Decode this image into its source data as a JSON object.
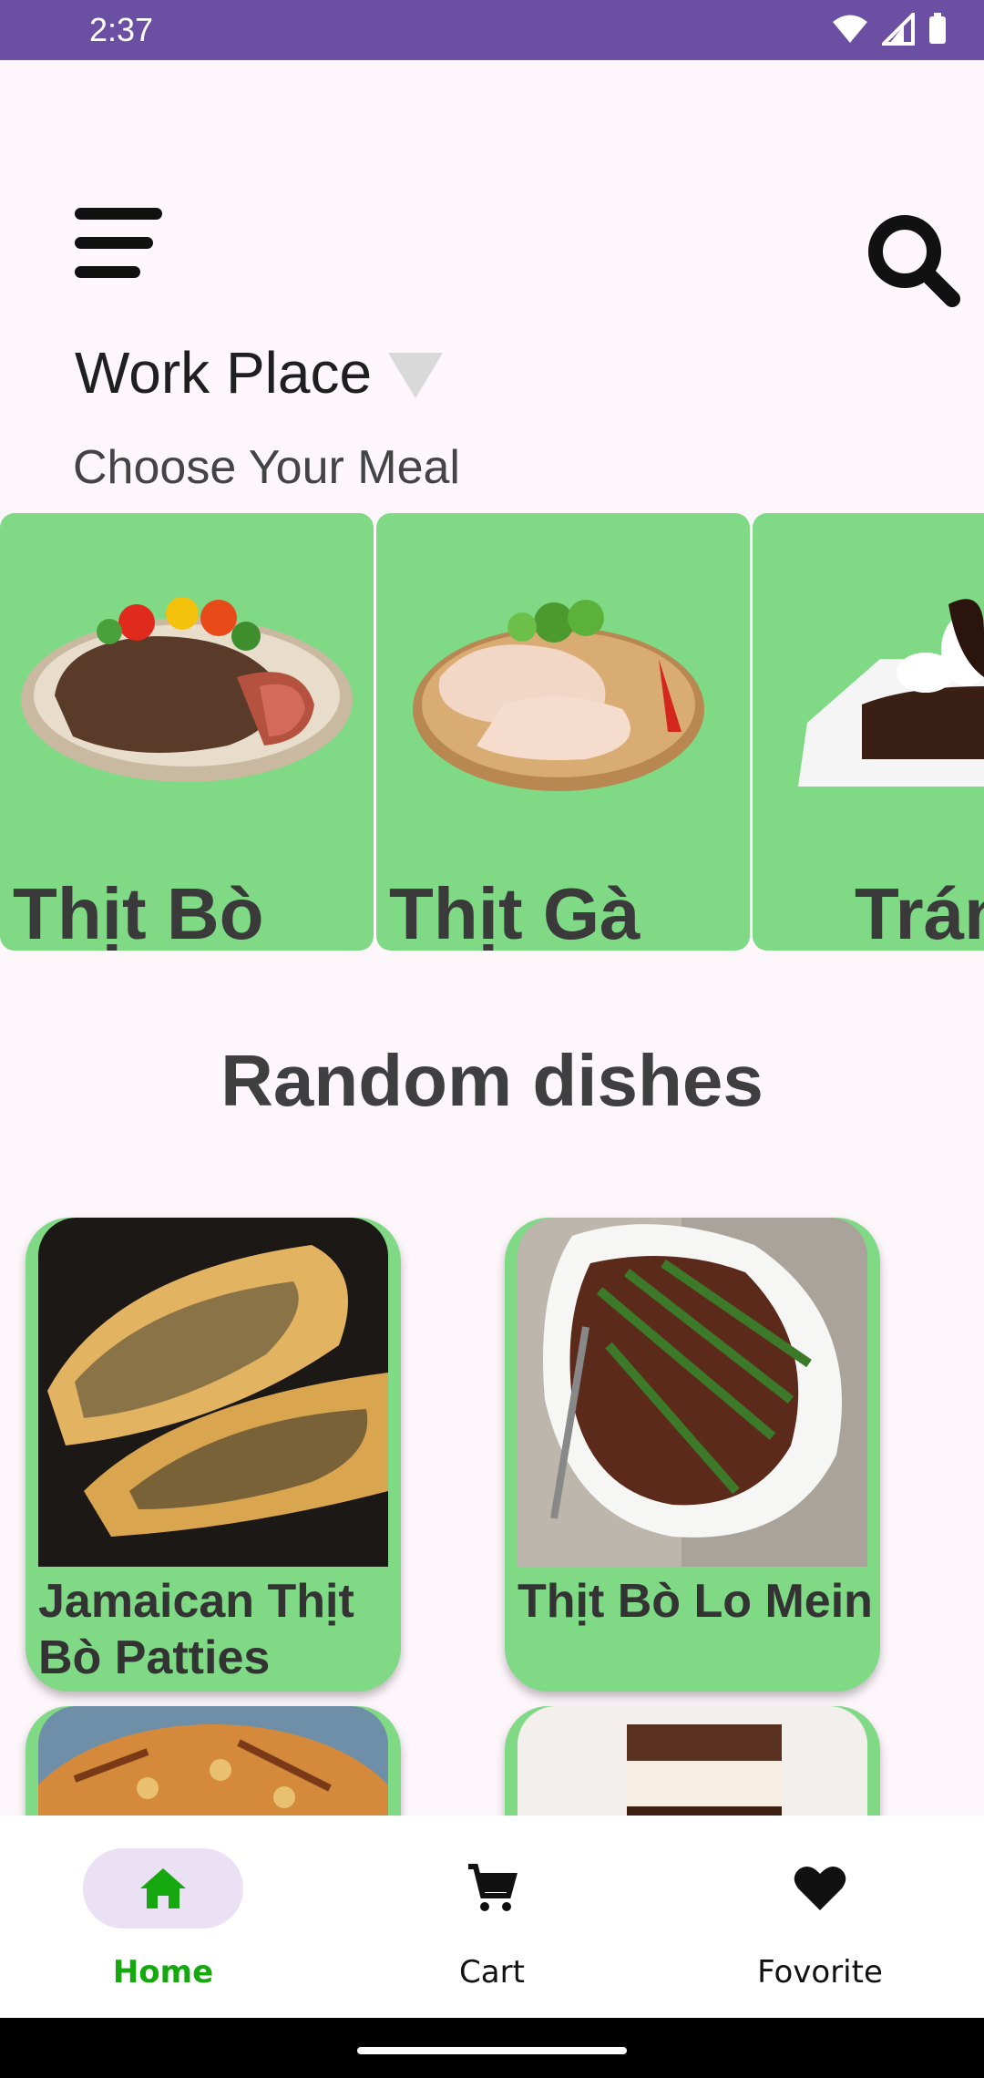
{
  "status": {
    "time": "2:37",
    "icons": [
      "wifi-icon",
      "signal-icon",
      "battery-icon"
    ]
  },
  "header": {
    "menu_icon": "menu-icon",
    "search_icon": "search-icon"
  },
  "location": {
    "label": "Work Place"
  },
  "subtitle": "Choose Your Meal",
  "categories": [
    {
      "label": "Thịt Bò"
    },
    {
      "label": "Thịt Gà"
    },
    {
      "label": "Trán"
    }
  ],
  "random_section": {
    "title": "Random dishes"
  },
  "dishes": [
    {
      "name": "Jamaican Thịt Bò Patties"
    },
    {
      "name": "Thịt Bò Lo Mein"
    },
    {
      "name": ""
    },
    {
      "name": ""
    }
  ],
  "bottom_nav": {
    "items": [
      {
        "label": "Home",
        "icon": "home-icon",
        "active": true
      },
      {
        "label": "Cart",
        "icon": "cart-icon",
        "active": false
      },
      {
        "label": "Fovorite",
        "icon": "heart-icon",
        "active": false
      }
    ]
  },
  "colors": {
    "accent": "#15a80f",
    "card_green": "#7fd985",
    "status_bar": "#6a4fa3",
    "active_pill": "#ebe1f5"
  }
}
